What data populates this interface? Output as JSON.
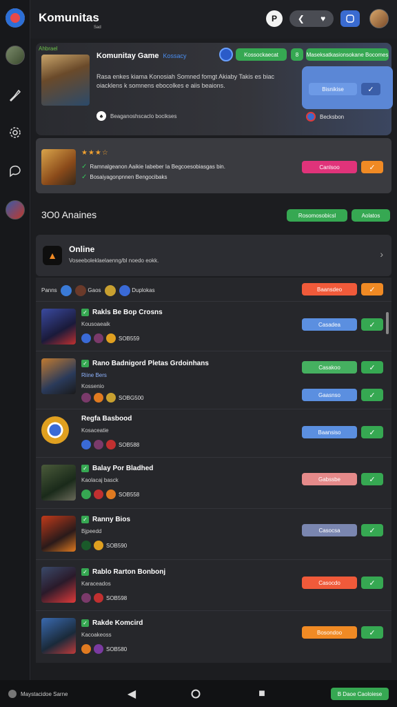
{
  "header": {
    "title": "Komunitas",
    "subtitle": "Sad",
    "round_btn": "P",
    "icons": [
      "rail-logo-icon",
      "back-arrow-icon",
      "heart-icon",
      "chat-square-icon"
    ]
  },
  "rail": {
    "items": [
      "avatar",
      "brush-icon",
      "gear-icon",
      "chat-bubble-icon",
      "avatar"
    ]
  },
  "featured": {
    "tag": "Ahbrael",
    "title": "Komunitay Game",
    "title_tag": "Kossacy",
    "description": "Rasa enkes kiama Konosiah Somned fomgt Akiaby Takis es biac oiacklens k somnens ebocolkes e aiis beaions.",
    "link": "Beaganoshscaclo bocikses",
    "pill_main": "Kossockaecat",
    "pill_small": "8",
    "pill_right": "Maseksatkasionsokane Bocomes",
    "cta_label": "Bisnikise",
    "cta_below": "Becksbon"
  },
  "card2": {
    "stars": "★★★☆",
    "line1": "Ramnalgeanon Aaikie Iabeber Ia Begcoesobiasgas bin.",
    "line2": "Bosaiyagonpnnen Bengocibaks",
    "button": "Canlsoo"
  },
  "section_title": "3O0 Anaines",
  "section_btn1": "Rosomosobicsl",
  "section_btn2": "Aolatos",
  "online": {
    "title": "Online",
    "subtitle": "Voseeboleklaelaenng/bl noedo eokk."
  },
  "list_header": {
    "label": "Panns",
    "label2": "Gaos",
    "label3": "Duplokas",
    "btn": "Baansdeo"
  },
  "rows": [
    {
      "name": "Rakls Be Bop Crosns",
      "sub": "Kousoaeaik",
      "meta": "SOB559",
      "btn": "Casadea"
    },
    {
      "name": "Rano Badnigord Pletas Grdoinhans",
      "sub": "Kossenio",
      "sub2": "Riine Bers",
      "meta": "SOBG500",
      "btn": "Casakoo",
      "btn2": "Gaasnso"
    },
    {
      "name": "Regfa Basbood",
      "sub": "Kosaceatie",
      "meta": "SOB588",
      "btn": "Baansiso"
    },
    {
      "name": "Balay Por Bladhed",
      "sub": "Kaolacaj basck",
      "meta": "SOB558",
      "btn": "Gabssbe"
    },
    {
      "name": "Ranny Bios",
      "sub": "Bjpeedd",
      "meta": "SOB590",
      "btn": "Casocsa"
    },
    {
      "name": "Rablo Rarton Bonbonj",
      "sub": "Karaceados",
      "meta": "SOB598",
      "btn": "Casocdo"
    },
    {
      "name": "Rakde Komcird",
      "sub": "Kacoakeoss",
      "meta": "SOB580",
      "btn": "Bosondoo"
    }
  ],
  "bottom_nav": {
    "label": "Maystacidoe Sarne",
    "cta": "B Daoe Caoloiese"
  },
  "colors": {
    "green": "#36a852",
    "blue": "#5b87d6",
    "orange": "#f08a24",
    "red": "#f05a3a",
    "pink": "#e0337a",
    "salmon": "#e58a8a",
    "slate": "#7a86b0"
  }
}
